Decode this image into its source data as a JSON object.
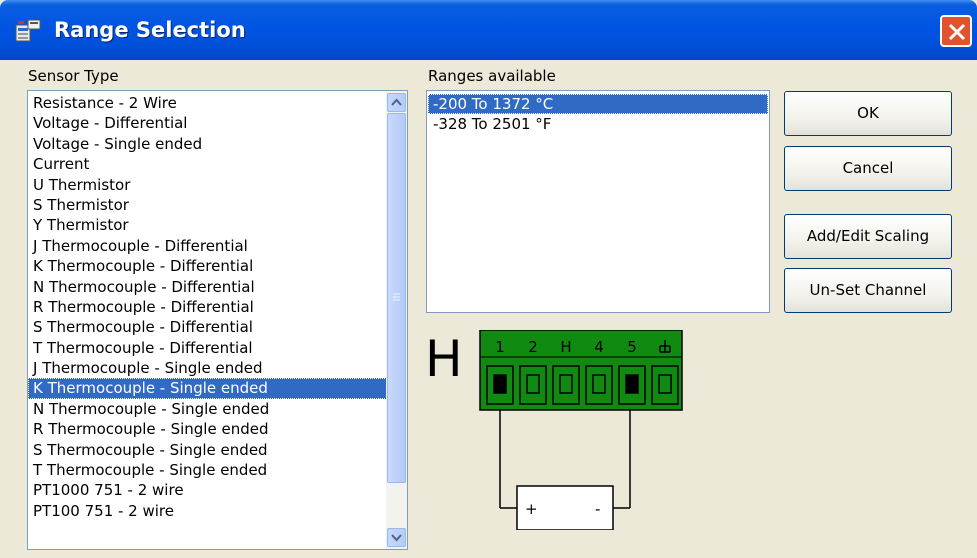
{
  "window": {
    "title": "Range Selection"
  },
  "sensor_type": {
    "label": "Sensor Type",
    "items": [
      "Resistance - 2 Wire",
      "Voltage - Differential",
      "Voltage - Single ended",
      "Current",
      "U  Thermistor",
      "S  Thermistor",
      "Y  Thermistor",
      "J Thermocouple - Differential",
      "K Thermocouple - Differential",
      "N Thermocouple - Differential",
      "R Thermocouple - Differential",
      "S Thermocouple - Differential",
      "T Thermocouple - Differential",
      "J Thermocouple - Single ended",
      "K Thermocouple - Single ended",
      "N Thermocouple - Single ended",
      "R Thermocouple - Single ended",
      "S Thermocouple - Single ended",
      "T Thermocouple - Single ended",
      "PT1000 751 - 2 wire",
      "PT100 751 - 2 wire"
    ],
    "selected_index": 14
  },
  "ranges": {
    "label": "Ranges available",
    "items": [
      "-200 To 1372 °C",
      "-328 To 2501 °F"
    ],
    "selected_index": 0
  },
  "buttons": {
    "ok": "OK",
    "cancel": "Cancel",
    "add_edit_scaling": "Add/Edit Scaling",
    "unset_channel": "Un-Set Channel"
  },
  "connector": {
    "channel_letter": "H",
    "pin_labels": [
      "1",
      "2",
      "H",
      "4",
      "5",
      "ground"
    ],
    "active_pins": [
      0,
      4
    ],
    "device_plus": "+",
    "device_minus": "-",
    "colors": {
      "block": "#118a11",
      "title_bar": "#0054e3",
      "selection": "#316ac5"
    }
  }
}
